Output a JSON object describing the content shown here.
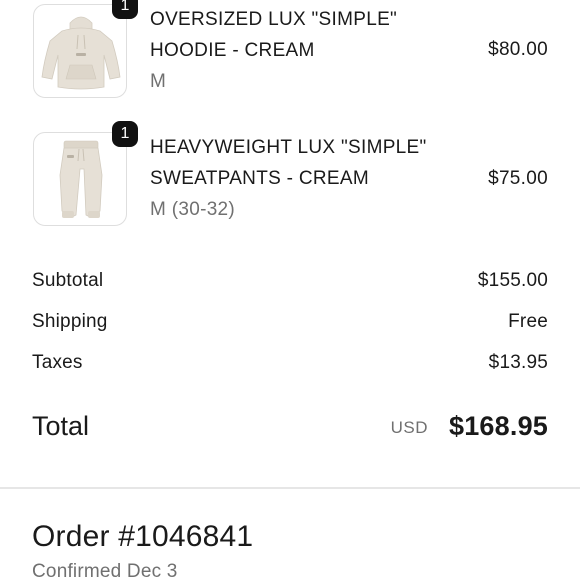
{
  "items": [
    {
      "quantity": "1",
      "title_line1": "OVERSIZED LUX \"SIMPLE\"",
      "title_line2": "HOODIE - CREAM",
      "variant": "M",
      "price": "$80.00",
      "image_icon": "hoodie-image"
    },
    {
      "quantity": "1",
      "title_line1": "HEAVYWEIGHT LUX \"SIMPLE\"",
      "title_line2": "SWEATPANTS - CREAM",
      "variant": "M (30-32)",
      "price": "$75.00",
      "image_icon": "sweatpants-image"
    }
  ],
  "summary": {
    "subtotal_label": "Subtotal",
    "subtotal_value": "$155.00",
    "shipping_label": "Shipping",
    "shipping_value": "Free",
    "taxes_label": "Taxes",
    "taxes_value": "$13.95"
  },
  "total": {
    "label": "Total",
    "currency": "USD",
    "amount": "$168.95"
  },
  "order": {
    "number": "Order #1046841",
    "confirmed": "Confirmed Dec 3"
  },
  "colors": {
    "product_cream": "#e4ded4",
    "badge": "#111111",
    "muted_text": "#707070"
  }
}
